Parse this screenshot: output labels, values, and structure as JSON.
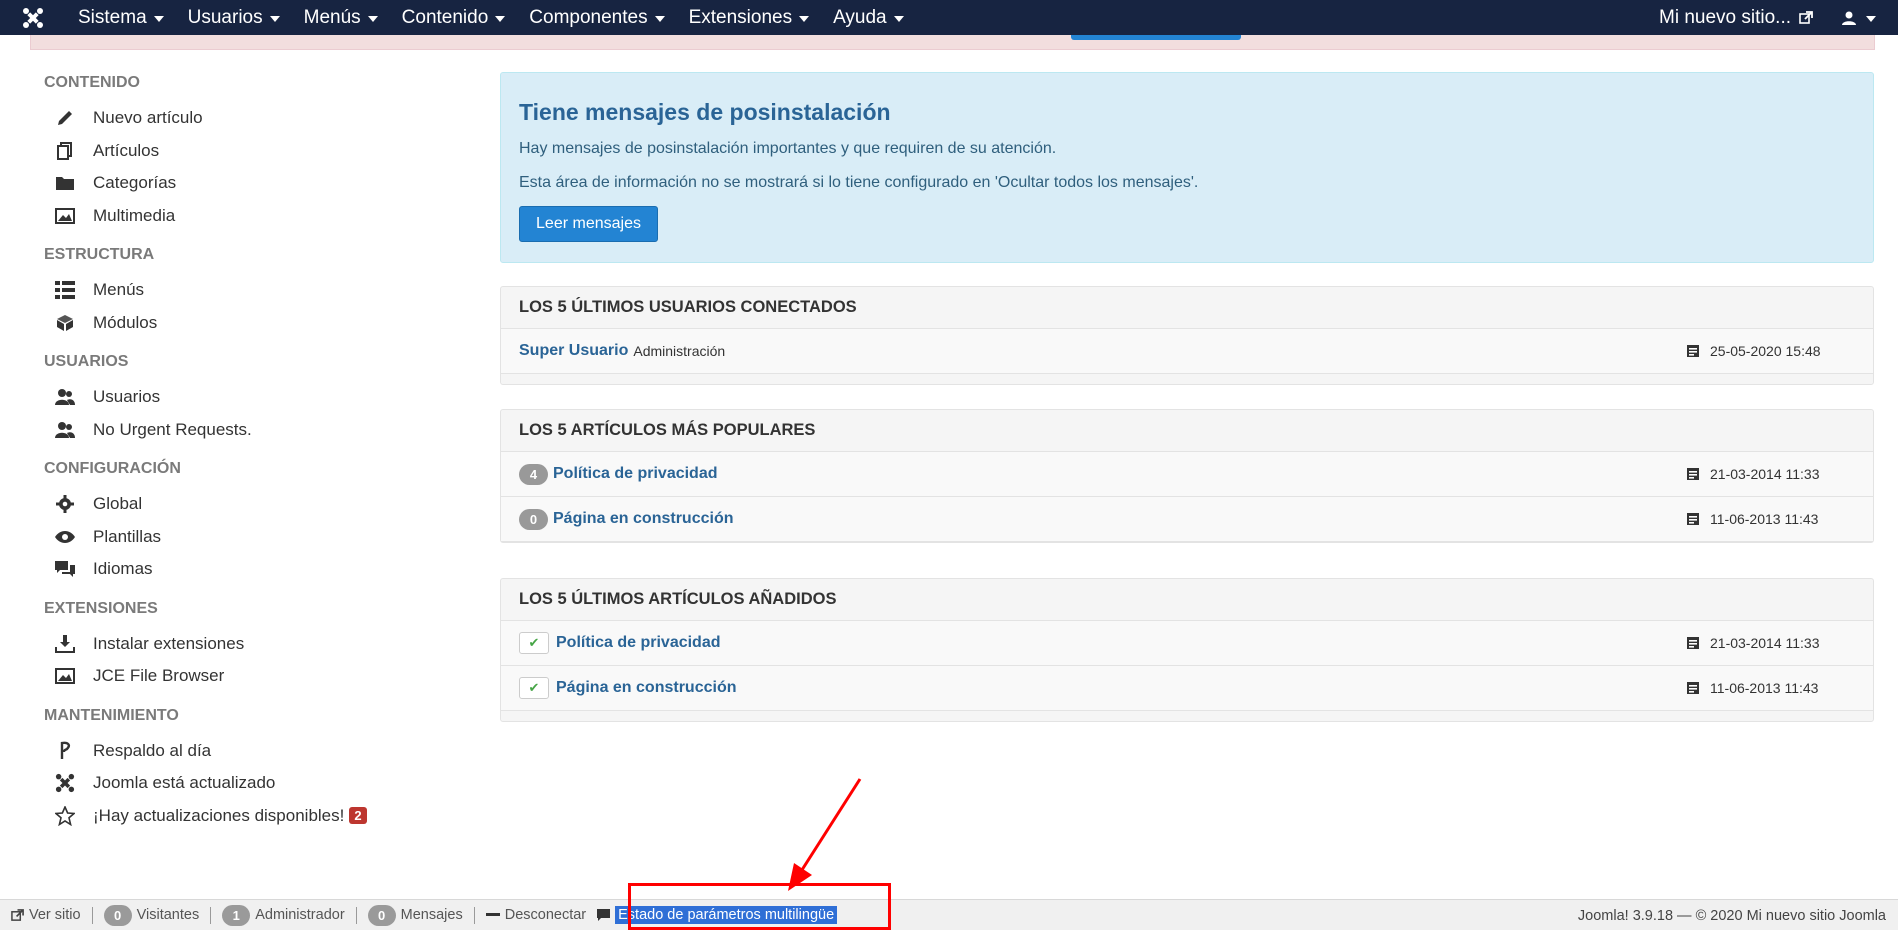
{
  "navbar": {
    "brand_icon": "joomla-logo-icon",
    "menus": [
      {
        "label": "Sistema"
      },
      {
        "label": "Usuarios"
      },
      {
        "label": "Menús"
      },
      {
        "label": "Contenido"
      },
      {
        "label": "Componentes"
      },
      {
        "label": "Extensiones"
      },
      {
        "label": "Ayuda"
      }
    ],
    "site_link": "Mi nuevo sitio...",
    "user_icon": "user-icon"
  },
  "sidebar": {
    "groups": [
      {
        "heading": "CONTENIDO",
        "items": [
          {
            "label": "Nuevo artículo",
            "icon": "pencil-icon"
          },
          {
            "label": "Artículos",
            "icon": "copy-icon"
          },
          {
            "label": "Categorías",
            "icon": "folder-icon"
          },
          {
            "label": "Multimedia",
            "icon": "image-icon"
          }
        ]
      },
      {
        "heading": "ESTRUCTURA",
        "items": [
          {
            "label": "Menús",
            "icon": "list-icon"
          },
          {
            "label": "Módulos",
            "icon": "cube-icon"
          }
        ]
      },
      {
        "heading": "USUARIOS",
        "items": [
          {
            "label": "Usuarios",
            "icon": "users-icon"
          },
          {
            "label": "No Urgent Requests.",
            "icon": "users-icon"
          }
        ]
      },
      {
        "heading": "CONFIGURACIÓN",
        "items": [
          {
            "label": "Global",
            "icon": "cog-icon"
          },
          {
            "label": "Plantillas",
            "icon": "eye-icon"
          },
          {
            "label": "Idiomas",
            "icon": "comments-icon"
          }
        ]
      },
      {
        "heading": "EXTENSIONES",
        "items": [
          {
            "label": "Instalar extensiones",
            "icon": "download-icon"
          },
          {
            "label": "JCE File Browser",
            "icon": "image-icon"
          }
        ]
      },
      {
        "heading": "MANTENIMIENTO",
        "items": [
          {
            "label": "Respaldo al día",
            "icon": "akeeba-icon"
          },
          {
            "label": "Joomla está actualizado",
            "icon": "joomla-icon"
          },
          {
            "label": "¡Hay actualizaciones disponibles!",
            "icon": "star-icon",
            "badge": "2"
          }
        ]
      }
    ]
  },
  "postinstall": {
    "title": "Tiene mensajes de posinstalación",
    "line1": "Hay mensajes de posinstalación importantes y que requiren de su atención.",
    "line2": "Esta área de información no se mostrará si lo tiene configurado en 'Ocultar todos los mensajes'.",
    "button": "Leer mensajes"
  },
  "logged_users": {
    "title": "LOS 5 ÚLTIMOS USUARIOS CONECTADOS",
    "rows": [
      {
        "name": "Super Usuario",
        "area": "Administración",
        "date": "25-05-2020 15:48"
      }
    ]
  },
  "popular": {
    "title": "LOS 5 ARTÍCULOS MÁS POPULARES",
    "rows": [
      {
        "hits": "4",
        "title": "Política de privacidad",
        "date": "21-03-2014 11:33"
      },
      {
        "hits": "0",
        "title": "Página en construcción",
        "date": "11-06-2013 11:43"
      }
    ]
  },
  "latest": {
    "title": "LOS 5 ÚLTIMOS ARTÍCULOS AÑADIDOS",
    "rows": [
      {
        "title": "Política de privacidad",
        "date": "21-03-2014 11:33"
      },
      {
        "title": "Página en construcción",
        "date": "11-06-2013 11:43"
      }
    ]
  },
  "status": {
    "view_site": "Ver sitio",
    "visitors_count": "0",
    "visitors": "Visitantes",
    "admin_count": "1",
    "admin": "Administrador",
    "messages_count": "0",
    "messages": "Mensajes",
    "logout": "Desconectar",
    "multilang": "Estado de parámetros multilingüe",
    "version": "Joomla! 3.9.18",
    "copyright": "© 2020 Mi nuevo sitio Joomla"
  },
  "colors": {
    "navbar": "#172441",
    "primary": "#2384d3",
    "annotation": "#ff0000"
  }
}
